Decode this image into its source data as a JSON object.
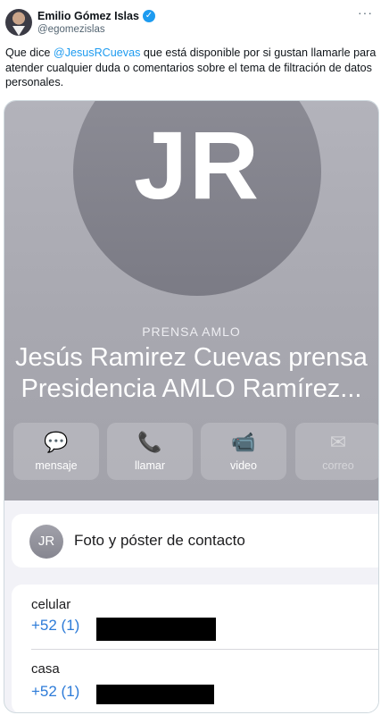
{
  "tweet": {
    "author_name": "Emilio Gómez Islas",
    "handle": "@egomezislas",
    "verified_glyph": "✓",
    "more_glyph": "···",
    "text_before": "Que dice ",
    "mention": "@JesusRCuevas",
    "text_after": " que está disponible por si gustan llamarle para atender cualquier duda o comentarios sobre el tema de filtración de datos personales."
  },
  "contact": {
    "monogram": "JR",
    "organization": "PRENSA AMLO",
    "name_line1": "Jesús Ramirez Cuevas prensa",
    "name_line2": "Presidencia AMLO Ramírez...",
    "actions": [
      {
        "label": "mensaje",
        "icon": "message-bubble-icon",
        "glyph": "💬",
        "enabled": true
      },
      {
        "label": "llamar",
        "icon": "phone-icon",
        "glyph": "📞",
        "enabled": true
      },
      {
        "label": "video",
        "icon": "video-camera-icon",
        "glyph": "📹",
        "enabled": true
      },
      {
        "label": "correo",
        "icon": "envelope-icon",
        "glyph": "✉",
        "enabled": false
      }
    ],
    "photo_card": {
      "avatar_text": "JR",
      "label": "Foto y póster de contacto"
    },
    "phones": [
      {
        "label": "celular",
        "number_visible": "+52 (1)"
      },
      {
        "label": "casa",
        "number_visible": "+52 (1)"
      }
    ]
  },
  "colors": {
    "accent": "#1d9bf0",
    "ios_link": "#2d7bd8",
    "redaction": "#000000"
  }
}
